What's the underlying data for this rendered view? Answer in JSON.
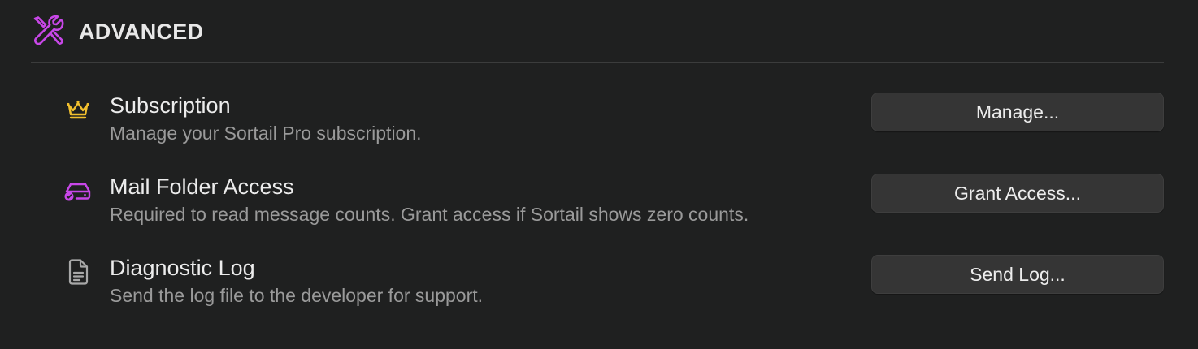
{
  "section": {
    "title": "ADVANCED",
    "icon": "tools-icon",
    "accent_color": "#c847e8"
  },
  "rows": [
    {
      "icon": "crown-icon",
      "icon_color": "#f2c02e",
      "title": "Subscription",
      "description": "Manage your Sortail Pro subscription.",
      "button_label": "Manage..."
    },
    {
      "icon": "drive-check-icon",
      "icon_color": "#c847e8",
      "title": "Mail Folder Access",
      "description": "Required to read message counts. Grant access if Sortail shows zero counts.",
      "button_label": "Grant Access..."
    },
    {
      "icon": "document-icon",
      "icon_color": "#a8a8a8",
      "title": "Diagnostic Log",
      "description": "Send the log file to the developer for support.",
      "button_label": "Send Log..."
    }
  ]
}
